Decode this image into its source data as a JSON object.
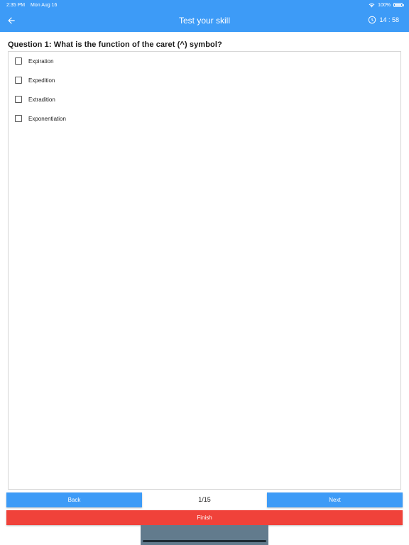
{
  "status_bar": {
    "time": "2:35 PM",
    "date": "Mon Aug 16",
    "battery": "100%",
    "wifi_icon": "wifi-icon",
    "battery_icon": "battery-icon"
  },
  "app_bar": {
    "title": "Test your skill",
    "back_icon": "arrow-left-icon",
    "timer_icon": "clock-icon",
    "timer": "14 : 58"
  },
  "question": {
    "text": "Question 1: What is the function of the caret (^) symbol?",
    "options": [
      {
        "label": "Expiration",
        "checked": false
      },
      {
        "label": "Expedition",
        "checked": false
      },
      {
        "label": "Extradition",
        "checked": false
      },
      {
        "label": "Exponentiation",
        "checked": false
      }
    ]
  },
  "navigation": {
    "back_label": "Back",
    "page_indicator": "1/15",
    "next_label": "Next",
    "finish_label": "Finish"
  },
  "colors": {
    "primary": "#3d9bf7",
    "finish": "#f0423a"
  }
}
